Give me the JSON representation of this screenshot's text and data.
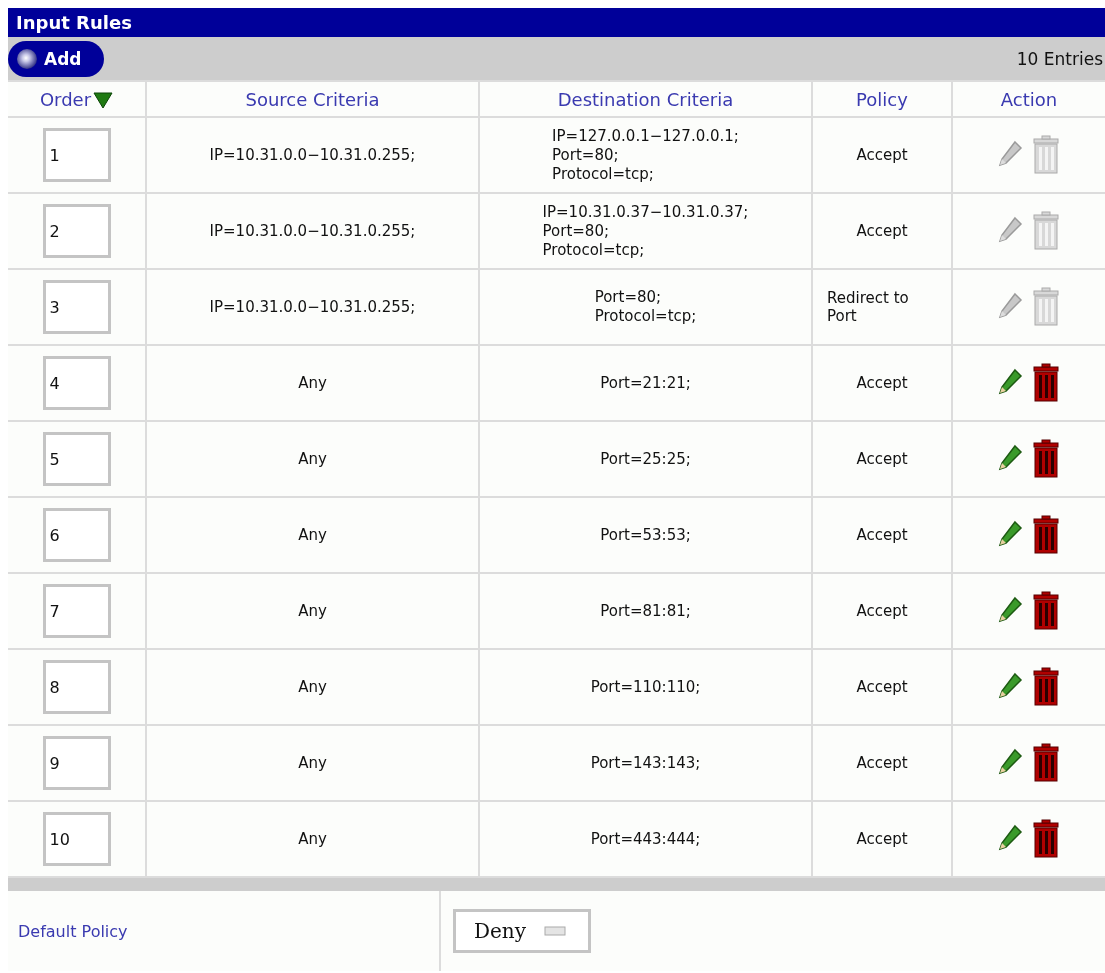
{
  "title": "Input Rules",
  "toolbar": {
    "add_label": "Add",
    "count": "10 Entries"
  },
  "columns": [
    {
      "label": "Order",
      "sorted": true
    },
    {
      "label": "Source Criteria",
      "sorted": false
    },
    {
      "label": "Destination Criteria",
      "sorted": false
    },
    {
      "label": "Policy",
      "sorted": false
    },
    {
      "label": "Action",
      "sorted": false
    }
  ],
  "rows": [
    {
      "order": "1",
      "source": "IP=10.31.0.0−10.31.0.255;",
      "destination": [
        "IP=127.0.0.1−127.0.0.1;",
        "Port=80;",
        "Protocol=tcp;"
      ],
      "policy": "Accept",
      "editable": false
    },
    {
      "order": "2",
      "source": "IP=10.31.0.0−10.31.0.255;",
      "destination": [
        "IP=10.31.0.37−10.31.0.37;",
        "Port=80;",
        "Protocol=tcp;"
      ],
      "policy": "Accept",
      "editable": false
    },
    {
      "order": "3",
      "source": "IP=10.31.0.0−10.31.0.255;",
      "destination": [
        "Port=80;",
        "Protocol=tcp;"
      ],
      "policy": "Redirect to Port",
      "editable": false
    },
    {
      "order": "4",
      "source": "Any",
      "destination": [
        "Port=21:21;"
      ],
      "policy": "Accept",
      "editable": true
    },
    {
      "order": "5",
      "source": "Any",
      "destination": [
        "Port=25:25;"
      ],
      "policy": "Accept",
      "editable": true
    },
    {
      "order": "6",
      "source": "Any",
      "destination": [
        "Port=53:53;"
      ],
      "policy": "Accept",
      "editable": true
    },
    {
      "order": "7",
      "source": "Any",
      "destination": [
        "Port=81:81;"
      ],
      "policy": "Accept",
      "editable": true
    },
    {
      "order": "8",
      "source": "Any",
      "destination": [
        "Port=110:110;"
      ],
      "policy": "Accept",
      "editable": true
    },
    {
      "order": "9",
      "source": "Any",
      "destination": [
        "Port=143:143;"
      ],
      "policy": "Accept",
      "editable": true
    },
    {
      "order": "10",
      "source": "Any",
      "destination": [
        "Port=443:444;"
      ],
      "policy": "Accept",
      "editable": true
    }
  ],
  "default_policy": {
    "label": "Default Policy",
    "value": "Deny"
  }
}
